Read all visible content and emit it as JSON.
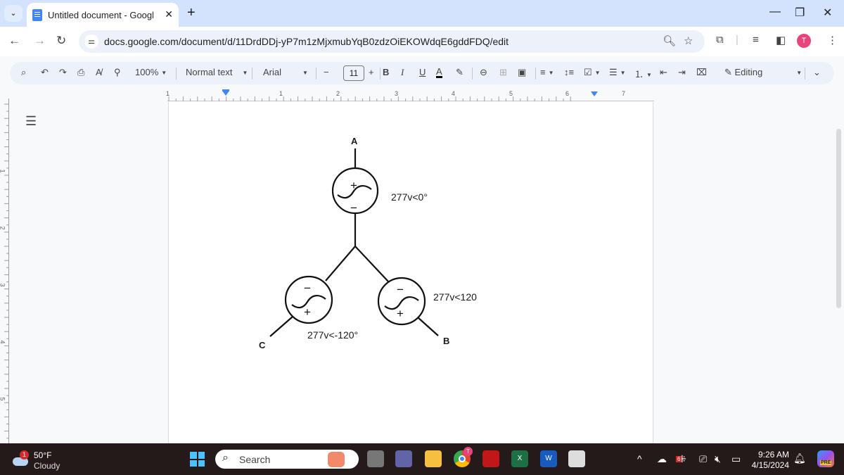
{
  "browser": {
    "tab_title": "Untitled document - Google Docs",
    "new_tab_label": "+",
    "url": "docs.google.com/document/d/11DrdDDj-yP7m1zMjxmubYqB0zdzOiEKOWdqE6gddFDQ/edit",
    "profile_initial": "T",
    "window_controls": {
      "minimize": "—",
      "restore": "❐",
      "close": "✕"
    }
  },
  "toolbar": {
    "zoom": "100%",
    "style": "Normal text",
    "font": "Arial",
    "font_size": "11",
    "bold": "B",
    "italic": "I",
    "underline": "U",
    "text_color": "A",
    "mode": "Editing"
  },
  "ruler": {
    "horizontal_marks": [
      "1",
      "1",
      "2",
      "3",
      "4",
      "5",
      "6",
      "7"
    ],
    "vertical_marks": [
      "1",
      "2",
      "3",
      "4",
      "5"
    ]
  },
  "diagram": {
    "phases": [
      {
        "node": "A",
        "label": "277v<0°"
      },
      {
        "node": "B",
        "label": "277v<120"
      },
      {
        "node": "C",
        "label": "277v<-120°"
      }
    ],
    "plus": "+",
    "minus": "−"
  },
  "taskbar": {
    "weather_temp": "50°F",
    "weather_cond": "Cloudy",
    "weather_badge": "1",
    "search_placeholder": "Search",
    "time": "9:26 AM",
    "date": "4/15/2024",
    "chrome_badge": "T",
    "tray_badge": "6",
    "copilot_badge": "PRE"
  }
}
